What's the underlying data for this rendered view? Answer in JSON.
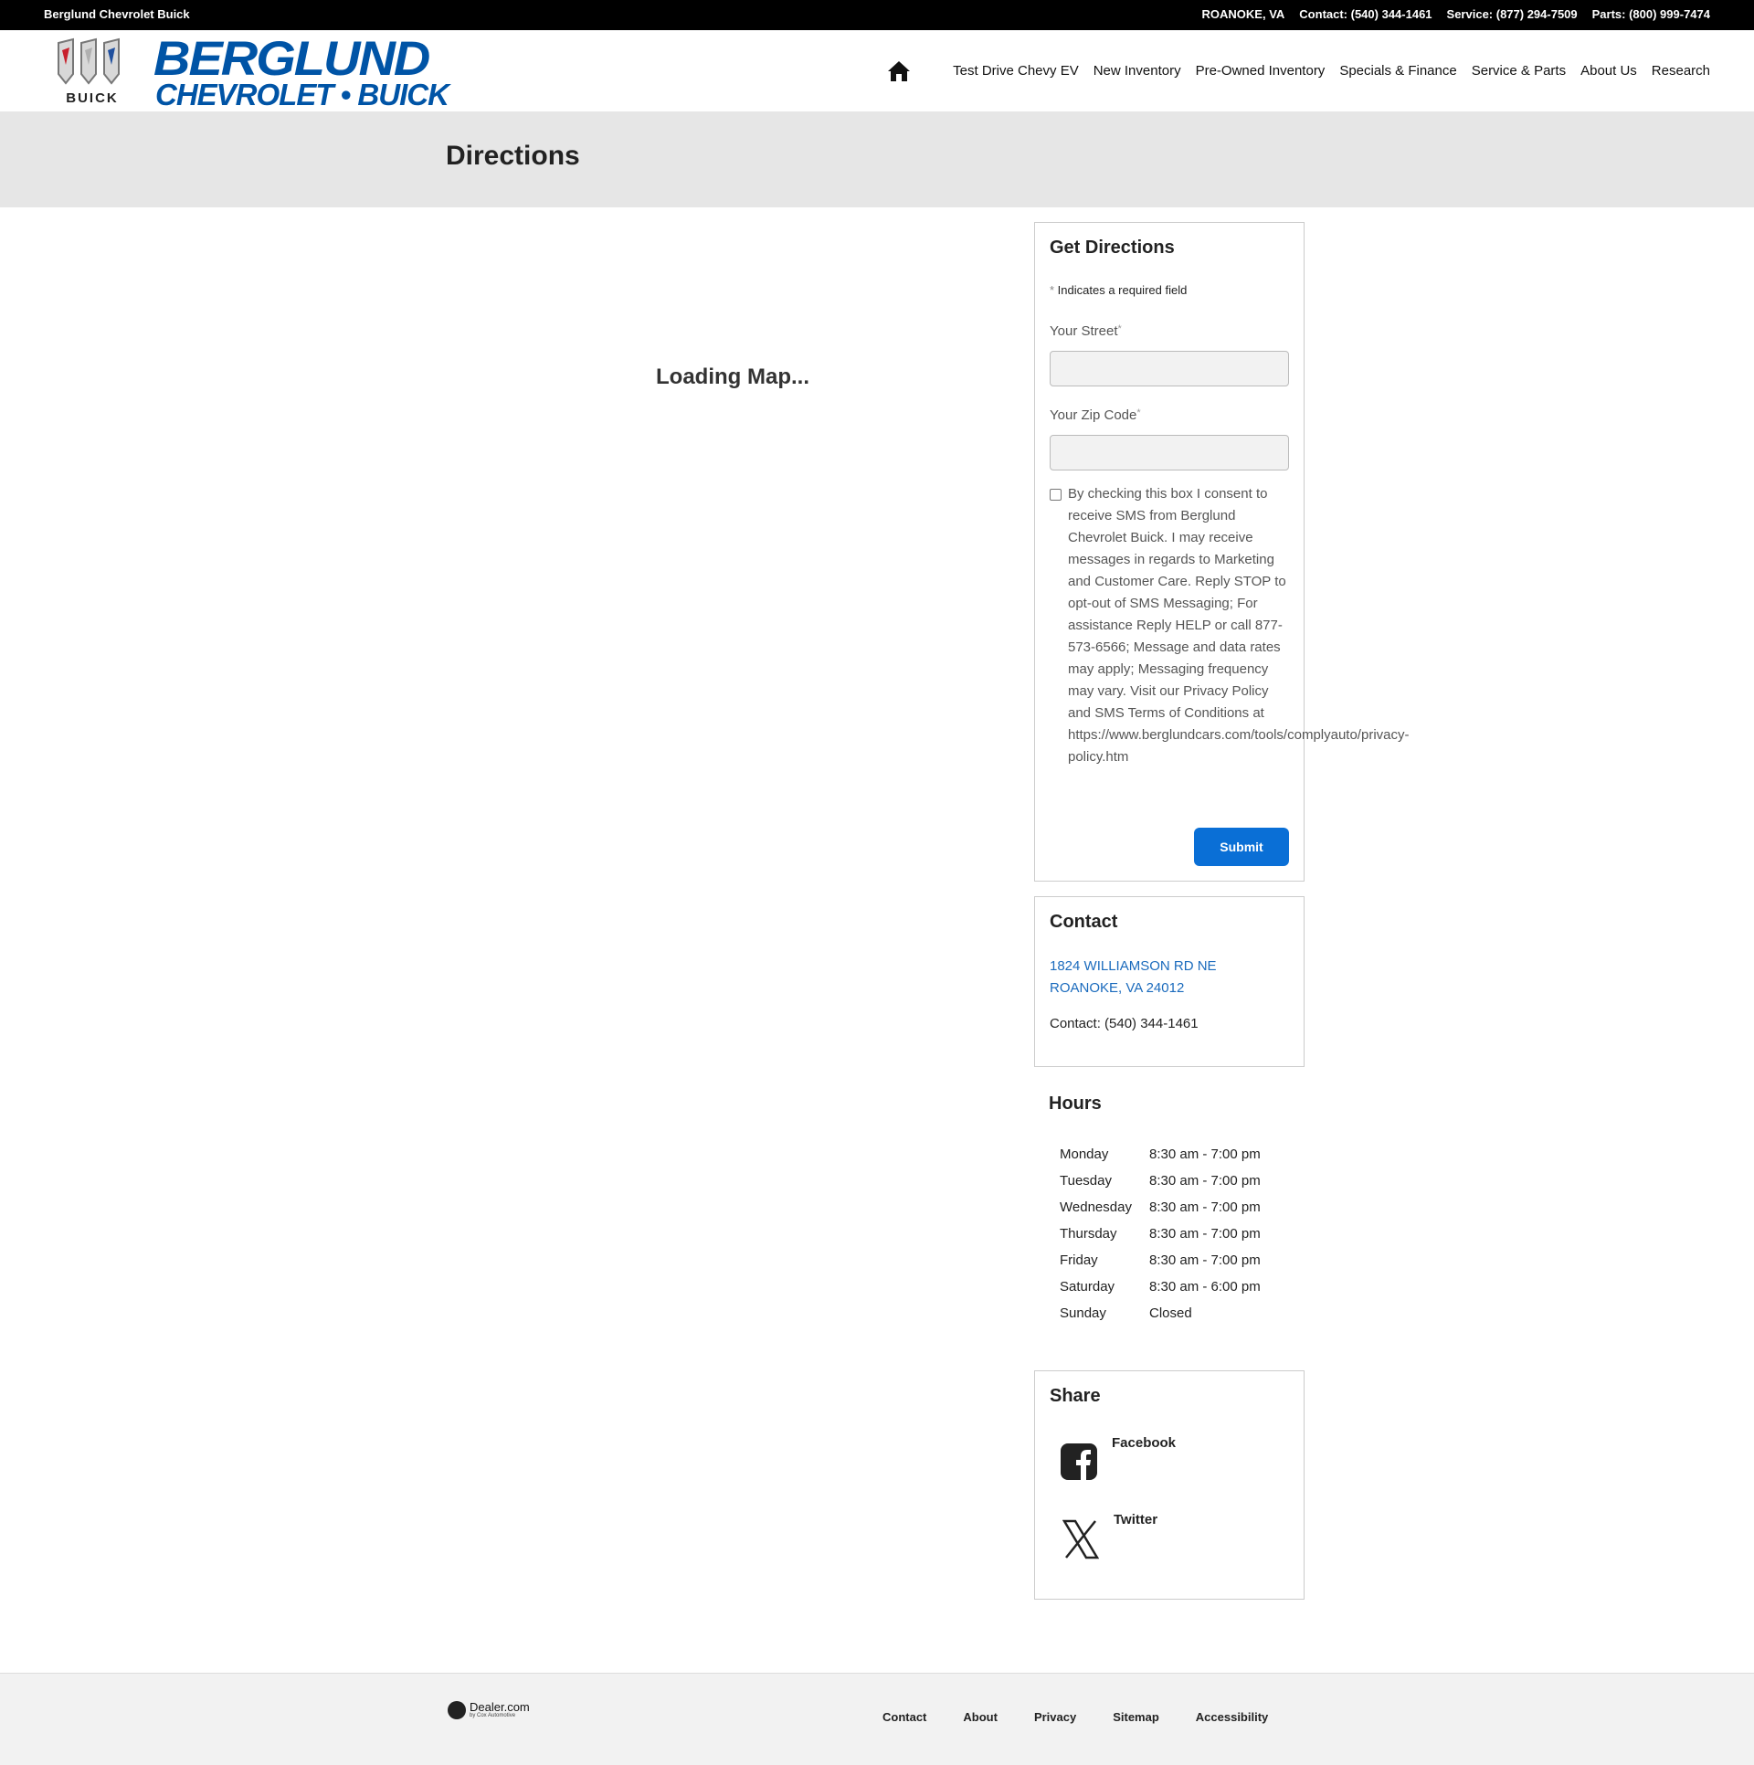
{
  "topbar": {
    "dealer_name": "Berglund Chevrolet Buick",
    "location": "ROANOKE, VA",
    "contact": "Contact: (540) 344-1461",
    "service": "Service: (877) 294-7509",
    "parts": "Parts: (800) 999-7474"
  },
  "header": {
    "buick_wordmark": "BUICK",
    "logo_line1": "BERGLUND",
    "logo_line2": "CHEVROLET • BUICK",
    "nav": [
      {
        "label": "Test Drive Chevy EV"
      },
      {
        "label": "New Inventory"
      },
      {
        "label": "Pre-Owned Inventory"
      },
      {
        "label": "Specials & Finance"
      },
      {
        "label": "Service & Parts"
      },
      {
        "label": "About Us"
      },
      {
        "label": "Research"
      }
    ]
  },
  "page": {
    "title": "Directions",
    "map_loading": "Loading Map..."
  },
  "directions_form": {
    "title": "Get Directions",
    "required_star": "*",
    "required_note": " Indicates a required field",
    "street_label": "Your Street",
    "street_value": "",
    "zip_label": "Your Zip Code",
    "zip_value": "",
    "consent_text": "By checking this box I consent to receive SMS from Berglund Chevrolet Buick. I may receive messages in regards to Marketing and Customer Care. Reply STOP to opt-out of SMS Messaging; For assistance Reply HELP or call 877-573-6566; Message and data rates may apply; Messaging frequency may vary. Visit our Privacy Policy and SMS Terms of Conditions at",
    "consent_url_part1": "https://www.berglundcars.com/tools/complyauto/privacy-",
    "consent_url_part2": "policy.htm",
    "consent_checked": false,
    "submit_label": "Submit"
  },
  "contact": {
    "title": "Contact",
    "address_line1": "1824 WILLIAMSON RD NE",
    "address_line2": "ROANOKE, VA 24012",
    "phone": "Contact: (540) 344-1461"
  },
  "hours": {
    "title": "Hours",
    "rows": [
      {
        "day": "Monday",
        "time": "8:30 am - 7:00 pm"
      },
      {
        "day": "Tuesday",
        "time": "8:30 am - 7:00 pm"
      },
      {
        "day": "Wednesday",
        "time": "8:30 am - 7:00 pm"
      },
      {
        "day": "Thursday",
        "time": "8:30 am - 7:00 pm"
      },
      {
        "day": "Friday",
        "time": "8:30 am - 7:00 pm"
      },
      {
        "day": "Saturday",
        "time": "8:30 am - 6:00 pm"
      },
      {
        "day": "Sunday",
        "time": "Closed"
      }
    ]
  },
  "share": {
    "title": "Share",
    "facebook_label": "Facebook",
    "twitter_label": "Twitter"
  },
  "footer": {
    "provider_name": "Dealer.com",
    "provider_sub": "by Cox Automotive",
    "links": [
      {
        "label": "Contact"
      },
      {
        "label": "About"
      },
      {
        "label": "Privacy"
      },
      {
        "label": "Sitemap"
      },
      {
        "label": "Accessibility"
      }
    ]
  },
  "colors": {
    "topbar_bg": "#000000",
    "brand_blue": "#0054a6",
    "link_blue": "#1b6bbd",
    "submit_blue": "#0a6fd6",
    "title_band_bg": "#e6e6e6",
    "footer_bg": "#f2f2f2"
  }
}
